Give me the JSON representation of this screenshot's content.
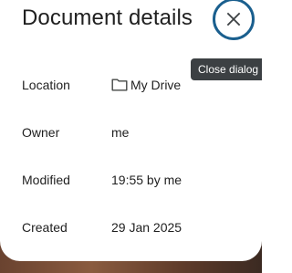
{
  "dialog": {
    "title": "Document details",
    "close_tooltip": "Close dialog"
  },
  "details": {
    "location": {
      "label": "Location",
      "value": "My Drive",
      "icon": "folder-icon"
    },
    "owner": {
      "label": "Owner",
      "value": "me"
    },
    "modified": {
      "label": "Modified",
      "value": "19:55 by me"
    },
    "created": {
      "label": "Created",
      "value": "29 Jan 2025"
    }
  },
  "colors": {
    "focus_ring": "#1a5f8e",
    "tooltip_bg": "#3c4043",
    "text": "#1f1f1f"
  }
}
